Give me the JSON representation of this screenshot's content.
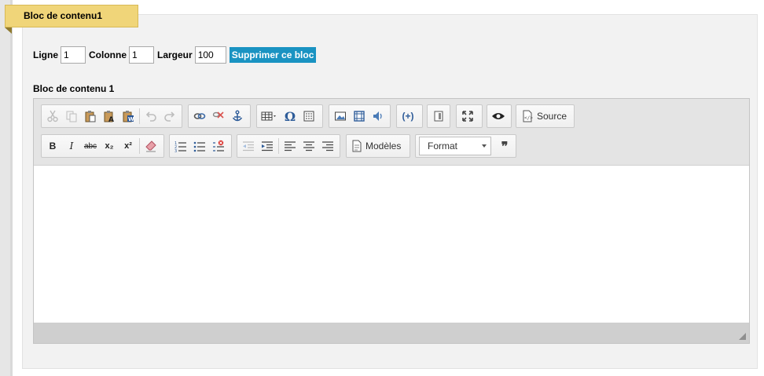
{
  "block": {
    "tab_title": "Bloc de contenu1",
    "ligne_label": "Ligne",
    "ligne_value": "1",
    "colonne_label": "Colonne",
    "colonne_value": "1",
    "largeur_label": "Largeur",
    "largeur_value": "100",
    "delete_label": "Supprimer ce bloc",
    "section_label": "Bloc de contenu 1"
  },
  "toolbar": {
    "source_label": "Source",
    "templates_label": "Modèles",
    "format_label": "Format",
    "bold": "B",
    "italic": "I",
    "strike": "abc",
    "subscript": "x₂",
    "superscript": "x²",
    "omega": "Ω",
    "quote": "❞",
    "iframe": "(+)"
  },
  "colors": {
    "tab_bg": "#f0d579",
    "delete_bg": "#1a93c2",
    "toolbar_bg": "#e4e4e4"
  }
}
